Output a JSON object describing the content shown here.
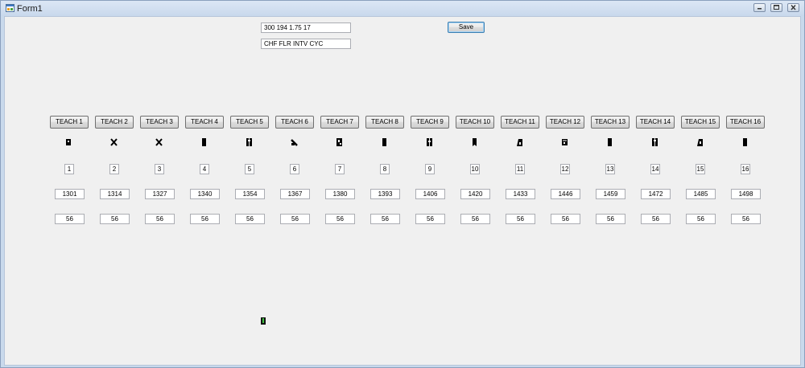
{
  "window": {
    "title": "Form1",
    "app_icon": "form-app-icon",
    "controls": {
      "minimize": "minimize-icon",
      "maximize": "maximize-icon",
      "close": "close-icon"
    }
  },
  "header": {
    "command_value": "300 194 1.75 17",
    "mode_value": "CHF FLR INTV CYC",
    "save_label": "Save"
  },
  "channels": [
    {
      "teach_label": "TEACH 1",
      "index": "1",
      "position": "1301",
      "count": "56",
      "glyph": "sensor-glyph-icon"
    },
    {
      "teach_label": "TEACH 2",
      "index": "2",
      "position": "1314",
      "count": "56",
      "glyph": "sensor-glyph-icon"
    },
    {
      "teach_label": "TEACH 3",
      "index": "3",
      "position": "1327",
      "count": "56",
      "glyph": "sensor-glyph-icon"
    },
    {
      "teach_label": "TEACH 4",
      "index": "4",
      "position": "1340",
      "count": "56",
      "glyph": "sensor-glyph-icon"
    },
    {
      "teach_label": "TEACH 5",
      "index": "5",
      "position": "1354",
      "count": "56",
      "glyph": "sensor-glyph-icon"
    },
    {
      "teach_label": "TEACH 6",
      "index": "6",
      "position": "1367",
      "count": "56",
      "glyph": "sensor-glyph-icon"
    },
    {
      "teach_label": "TEACH 7",
      "index": "7",
      "position": "1380",
      "count": "56",
      "glyph": "sensor-glyph-icon"
    },
    {
      "teach_label": "TEACH 8",
      "index": "8",
      "position": "1393",
      "count": "56",
      "glyph": "sensor-glyph-icon"
    },
    {
      "teach_label": "TEACH 9",
      "index": "9",
      "position": "1406",
      "count": "56",
      "glyph": "sensor-glyph-icon"
    },
    {
      "teach_label": "TEACH 10",
      "index": "10",
      "position": "1420",
      "count": "56",
      "glyph": "sensor-glyph-icon"
    },
    {
      "teach_label": "TEACH 11",
      "index": "11",
      "position": "1433",
      "count": "56",
      "glyph": "sensor-glyph-icon"
    },
    {
      "teach_label": "TEACH 12",
      "index": "12",
      "position": "1446",
      "count": "56",
      "glyph": "sensor-glyph-icon"
    },
    {
      "teach_label": "TEACH 13",
      "index": "13",
      "position": "1459",
      "count": "56",
      "glyph": "sensor-glyph-icon"
    },
    {
      "teach_label": "TEACH 14",
      "index": "14",
      "position": "1472",
      "count": "56",
      "glyph": "sensor-glyph-icon"
    },
    {
      "teach_label": "TEACH 15",
      "index": "15",
      "position": "1485",
      "count": "56",
      "glyph": "sensor-glyph-icon"
    },
    {
      "teach_label": "TEACH 16",
      "index": "16",
      "position": "1498",
      "count": "56",
      "glyph": "sensor-glyph-icon"
    }
  ],
  "status_glyph": "status-indicator-icon",
  "colors": {
    "titlebar": "#c9d9ec",
    "client": "#f0f0f0",
    "status_glyph": "#2f8f2f"
  }
}
